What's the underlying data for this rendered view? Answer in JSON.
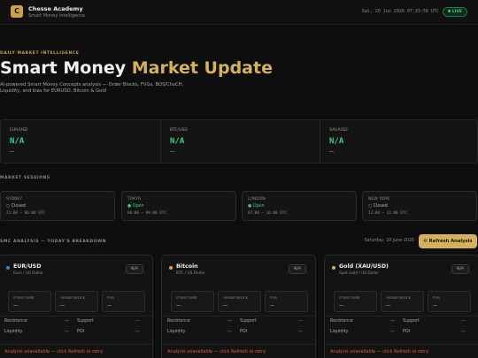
{
  "header": {
    "logo_letter": "C",
    "brand_name": "Chesse Academy",
    "brand_sub": "Smart Money Intelligence",
    "clock": "Sat, 20 Jun 2026 07:33:56 UTC",
    "live_label": "LIVE"
  },
  "hero": {
    "eyebrow": "DAILY MARKET INTELLIGENCE",
    "title_white": "Smart Money ",
    "title_gold": "Market Update",
    "description": "AI-powered Smart Money Concepts analysis — Order Blocks, FVGs, BOS/ChoCH, Liquidity, and bias for EURUSD, Bitcoin & Gold"
  },
  "prices": [
    {
      "symbol": "EUR/USD",
      "value": "N/A",
      "change": "—"
    },
    {
      "symbol": "BTC/USD",
      "value": "N/A",
      "change": "—"
    },
    {
      "symbol": "XAU/USD",
      "value": "N/A",
      "change": "—"
    }
  ],
  "sessions_label": "MARKET SESSIONS",
  "sessions": [
    {
      "name": "SYDNEY",
      "status": "○ Closed",
      "hours": "21:00 – 06:00 UTC"
    },
    {
      "name": "TOKYO",
      "status": "● Open",
      "hours": "00:00 – 09:00 UTC"
    },
    {
      "name": "LONDON",
      "status": "● Open",
      "hours": "07:00 – 16:00 UTC"
    },
    {
      "name": "NEW YORK",
      "status": "○ Closed",
      "hours": "13:00 – 21:00 UTC"
    }
  ],
  "analysis": {
    "label": "SMC ANALYSIS — TODAY'S BREAKDOWN",
    "date": "Saturday, 20 June 2026",
    "refresh_label": "⟳  Refresh Analysis"
  },
  "cards": [
    {
      "title": "EUR/USD",
      "sub": "Euro / US Dollar",
      "badge": "N/A",
      "dot_color": "#3b82f6",
      "structure_label": "STRUCTURE",
      "structure": "—",
      "ob_label": "ORDER BLOCK",
      "ob": "—",
      "fvg_label": "FVG",
      "fvg": "—",
      "resistance_label": "Resistance",
      "resistance": "—",
      "support_label": "Support",
      "support": "—",
      "liquidity_label": "Liquidity",
      "liquidity": "—",
      "poi_label": "POI",
      "poi": "—",
      "error": "Analysis unavailable — click Refresh to retry."
    },
    {
      "title": "Bitcoin",
      "sub": "BTC / US Dollar",
      "badge": "N/A",
      "dot_color": "#f59e0b",
      "structure_label": "STRUCTURE",
      "structure": "—",
      "ob_label": "ORDER BLOCK",
      "ob": "—",
      "fvg_label": "FVG",
      "fvg": "—",
      "resistance_label": "Resistance",
      "resistance": "—",
      "support_label": "Support",
      "support": "—",
      "liquidity_label": "Liquidity",
      "liquidity": "—",
      "poi_label": "POI",
      "poi": "—",
      "error": "Analysis unavailable — click Refresh to retry."
    },
    {
      "title": "Gold (XAU/USD)",
      "sub": "Spot Gold / US Dollar",
      "badge": "N/A",
      "dot_color": "#d6b15c",
      "structure_label": "STRUCTURE",
      "structure": "—",
      "ob_label": "ORDER BLOCK",
      "ob": "—",
      "fvg_label": "FVG",
      "fvg": "—",
      "resistance_label": "Resistance",
      "resistance": "—",
      "support_label": "Support",
      "support": "—",
      "liquidity_label": "Liquidity",
      "liquidity": "—",
      "poi_label": "POI",
      "poi": "—",
      "error": "Analysis unavailable — click Refresh to retry."
    }
  ]
}
